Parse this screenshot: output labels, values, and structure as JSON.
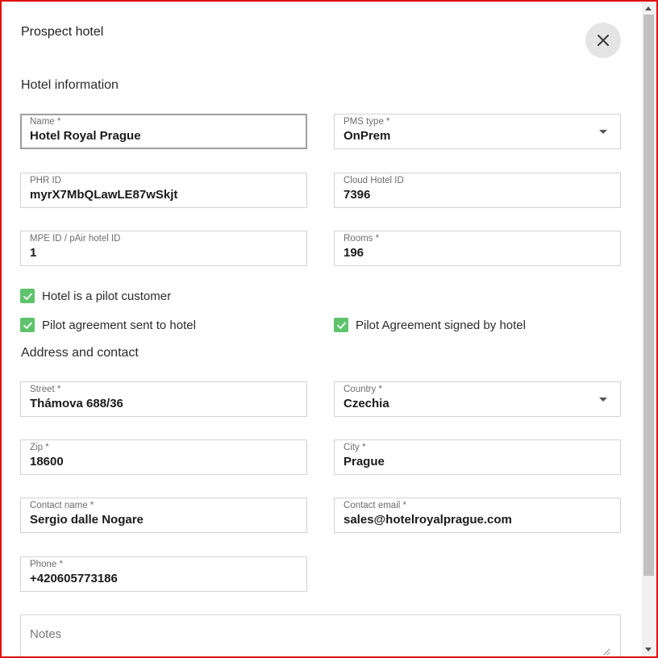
{
  "dialog": {
    "title": "Prospect hotel",
    "close_icon": "close-icon"
  },
  "sections": {
    "hotel_info": "Hotel information",
    "address_contact": "Address and contact"
  },
  "fields": {
    "name": {
      "label": "Name *",
      "value": "Hotel Royal Prague"
    },
    "pms_type": {
      "label": "PMS type *",
      "value": "OnPrem"
    },
    "phr_id": {
      "label": "PHR ID",
      "value": "myrX7MbQLawLE87wSkjt"
    },
    "cloud_hotel_id": {
      "label": "Cloud Hotel ID",
      "value": "7396"
    },
    "mpe_id": {
      "label": "MPE ID / pAir hotel ID",
      "value": "1"
    },
    "rooms": {
      "label": "Rooms *",
      "value": "196"
    },
    "street": {
      "label": "Street *",
      "value": "Thámova 688/36"
    },
    "country": {
      "label": "Country *",
      "value": "Czechia"
    },
    "zip": {
      "label": "Zip *",
      "value": "18600"
    },
    "city": {
      "label": "City *",
      "value": "Prague"
    },
    "contact_name": {
      "label": "Contact name *",
      "value": "Sergio dalle Nogare"
    },
    "contact_email": {
      "label": "Contact email *",
      "value": "sales@hotelroyalprague.com"
    },
    "phone": {
      "label": "Phone *",
      "value": "+420605773186"
    },
    "notes": {
      "placeholder": "Notes",
      "value": ""
    }
  },
  "checkboxes": {
    "pilot_customer": {
      "label": "Hotel is a pilot customer",
      "checked": true
    },
    "agreement_sent": {
      "label": "Pilot agreement sent to hotel",
      "checked": true
    },
    "agreement_signed": {
      "label": "Pilot Agreement signed by hotel",
      "checked": true
    }
  },
  "colors": {
    "check_accent": "#5fc36c",
    "window_border": "#e01010"
  }
}
